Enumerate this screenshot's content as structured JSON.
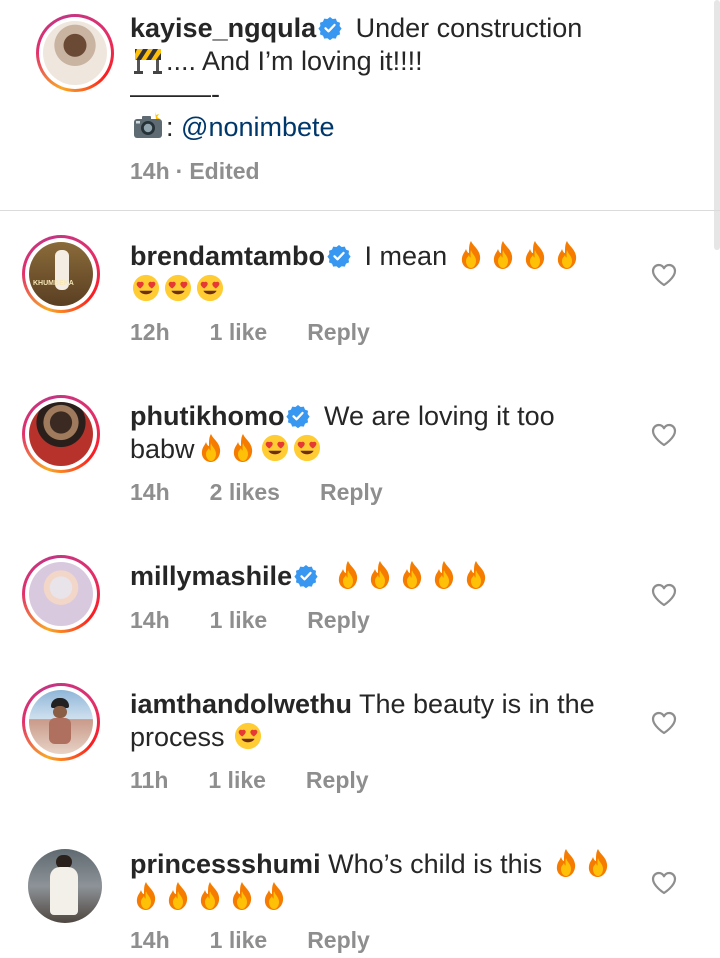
{
  "caption": {
    "username": "kayise_ngqula",
    "line1": "Under construction",
    "line2": ".... And I’m loving it!!!!",
    "line3": "———-",
    "credit_sep": ":",
    "mention": "@nonimbete",
    "time": "14h",
    "dot": "·",
    "edited": "Edited"
  },
  "comments": [
    {
      "username": "brendamtambo",
      "text_line1": "I mean",
      "time": "12h",
      "likes": "1 like",
      "reply": "Reply"
    },
    {
      "username": "phutikhomo",
      "text_line1": "We are loving it too",
      "text_line2": "babw",
      "time": "14h",
      "likes": "2 likes",
      "reply": "Reply"
    },
    {
      "username": "millymashile",
      "time": "14h",
      "likes": "1 like",
      "reply": "Reply"
    },
    {
      "username": "iamthandolwethu",
      "text_line1": "The beauty is in the",
      "text_line2": "process",
      "time": "11h",
      "likes": "1 like",
      "reply": "Reply"
    },
    {
      "username": "princessshumi",
      "text_line1": "Who’s child is this",
      "time": "14h",
      "likes": "1 like",
      "reply": "Reply"
    }
  ],
  "colors": {
    "verified": "#3897f0",
    "mention": "#00376b",
    "meta": "#8e8e8e",
    "fire": "#f9a825"
  }
}
